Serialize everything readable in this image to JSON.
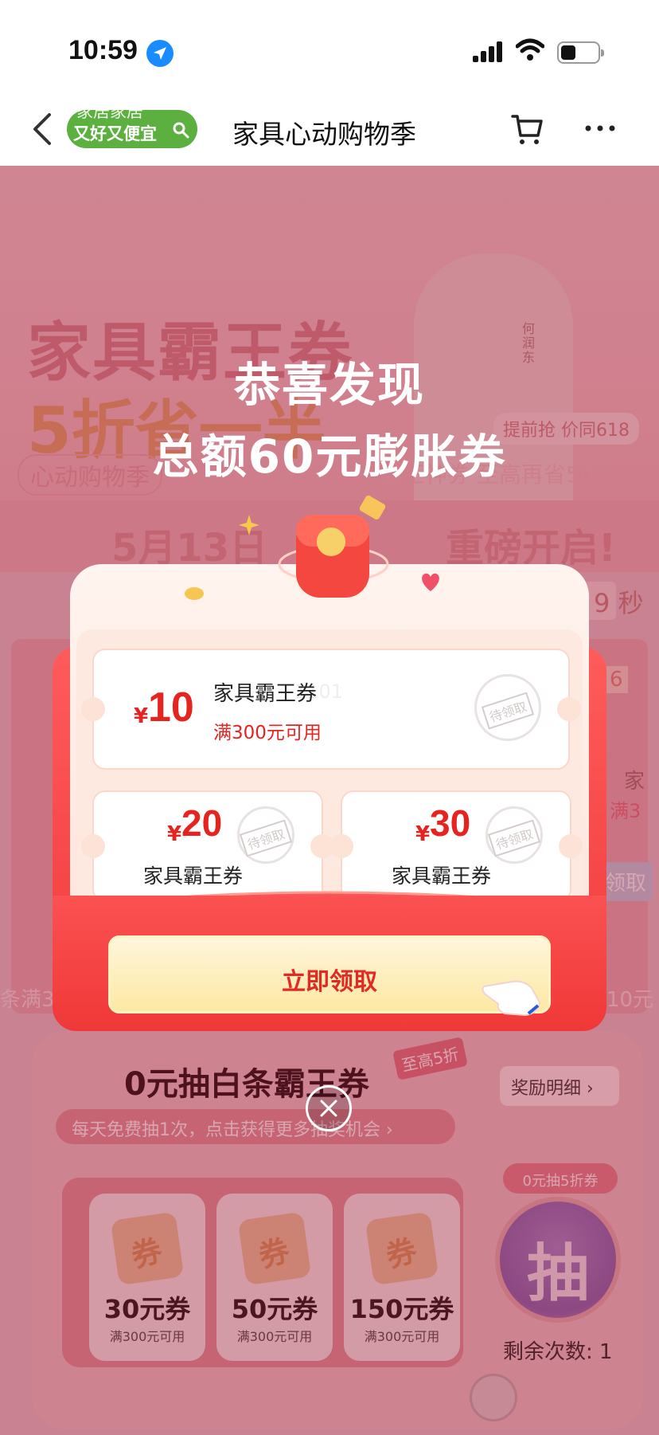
{
  "status_bar": {
    "time": "10:59"
  },
  "nav": {
    "pill_line1": "家居家居",
    "pill_line2": "又好又便宜",
    "title": "家具心动购物季"
  },
  "background": {
    "banner_line1": "家具霸王券",
    "banner_line2": "5折省一半",
    "banner_sub1": "心动购物季",
    "banner_sub2": "领霸王神券 至高再省50%",
    "person_name": "何润东",
    "banner_tag": "提前抢 价同618",
    "strip_left": "5月13日",
    "strip_right": "重磅开启!",
    "countdown_digit": "9",
    "countdown_unit": "秒",
    "side_num": "6",
    "side_text1": "家",
    "side_text2": "满3",
    "side_btn": "领取",
    "bottom_left": "条满3",
    "bottom_right": "10元"
  },
  "lottery": {
    "title": "0元抽白条霸王券",
    "tag": "至高5折",
    "subtitle": "每天免费抽1次，点击获得更多抽奖机会 ›",
    "reward_detail": "奖励明细 ›",
    "prizes": [
      {
        "icon_text": "券",
        "amount": "30元券",
        "condition": "满300元可用"
      },
      {
        "icon_text": "券",
        "amount": "50元券",
        "condition": "满300元可用"
      },
      {
        "icon_text": "券",
        "amount": "150元券",
        "condition": "满300元可用"
      }
    ],
    "draw_pill": "0元抽5折券",
    "draw_button": "抽",
    "remaining": "剩余次数: 1"
  },
  "modal": {
    "heading_line1": "恭喜发现",
    "heading_line2": "总额60元膨胀券",
    "coupons": [
      {
        "currency": "¥",
        "amount": "10",
        "name": "家具霸王券",
        "condition": "满300元可用",
        "stamp": "待领取"
      },
      {
        "currency": "¥",
        "amount": "20",
        "name": "家具霸王券",
        "stamp": "待领取"
      },
      {
        "currency": "¥",
        "amount": "30",
        "name": "家具霸王券",
        "stamp": "待领取"
      }
    ],
    "faint_code": "1101",
    "claim_button": "立即领取"
  },
  "colors": {
    "accent_red": "#e7231f",
    "envelope_red": "#f03a3a",
    "overlay": "#8c001e",
    "pill_green": "#5cb040"
  },
  "icons": [
    "location-arrow-icon",
    "signal-icon",
    "wifi-icon",
    "battery-icon",
    "back-icon",
    "search-icon",
    "cart-icon",
    "more-icon",
    "red-packet-icon",
    "hand-pointer-icon",
    "close-icon",
    "coupon-icon",
    "smile-icon"
  ]
}
